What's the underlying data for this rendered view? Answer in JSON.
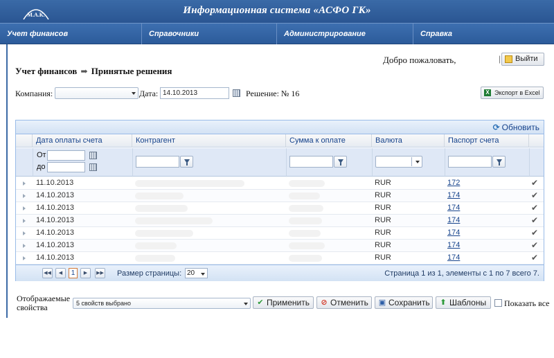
{
  "header": {
    "logo_text": "М.А.К.",
    "title": "Информационная система «АСФО ГК»"
  },
  "menu": [
    {
      "label": "Учет финансов"
    },
    {
      "label": "Справочники"
    },
    {
      "label": "Администрирование"
    },
    {
      "label": "Справка"
    }
  ],
  "user": {
    "welcome": "Добро пожаловать,",
    "separator": "|",
    "logout_label": "Выйти"
  },
  "breadcrumb": {
    "section": "Учет финансов",
    "page": "Принятые решения"
  },
  "filters": {
    "company_label": "Компания:",
    "company_value": "",
    "date_label": "Дата:",
    "date_value": "14.10.2013",
    "decision_label": "Решение: № 16",
    "export_label": "Экспорт в Excel"
  },
  "grid": {
    "refresh_label": "Обновить",
    "columns": [
      "Дата оплаты счета",
      "Контрагент",
      "Сумма к оплате",
      "Валюта",
      "Паспорт счета"
    ],
    "date_from_label": "От",
    "date_to_label": "до",
    "rows": [
      {
        "date": "11.10.2013",
        "currency": "RUR",
        "passport": "172"
      },
      {
        "date": "14.10.2013",
        "currency": "RUR",
        "passport": "174"
      },
      {
        "date": "14.10.2013",
        "currency": "RUR",
        "passport": "174"
      },
      {
        "date": "14.10.2013",
        "currency": "RUR",
        "passport": "174"
      },
      {
        "date": "14.10.2013",
        "currency": "RUR",
        "passport": "174"
      },
      {
        "date": "14.10.2013",
        "currency": "RUR",
        "passport": "174"
      },
      {
        "date": "14.10.2013",
        "currency": "RUR",
        "passport": "174"
      }
    ],
    "pager": {
      "current_page": "1",
      "page_size_label": "Размер страницы:",
      "page_size": "20",
      "info": "Страница 1 из 1, элементы с 1 по 7 всего 7."
    }
  },
  "footer": {
    "props_label": "Отображаемые свойства",
    "props_value": "5 свойств выбрано",
    "apply_label": "Применить",
    "cancel_label": "Отменить",
    "save_label": "Сохранить",
    "templates_label": "Шаблоны",
    "show_all_label": "Показать все"
  },
  "icons": {
    "logout": "logout-icon",
    "calendar": "calendar-icon",
    "excel": "excel-icon",
    "refresh": "refresh-icon",
    "filter": "funnel-icon",
    "check": "check-icon",
    "apply": "check-icon",
    "cancel": "cancel-icon",
    "save": "save-icon",
    "templates": "arrow-up-icon"
  },
  "colors": {
    "header_bg": "#2a5592",
    "menu_bg": "#3d6fb0",
    "grid_header": "#dfe8f6",
    "link": "#15428b"
  }
}
